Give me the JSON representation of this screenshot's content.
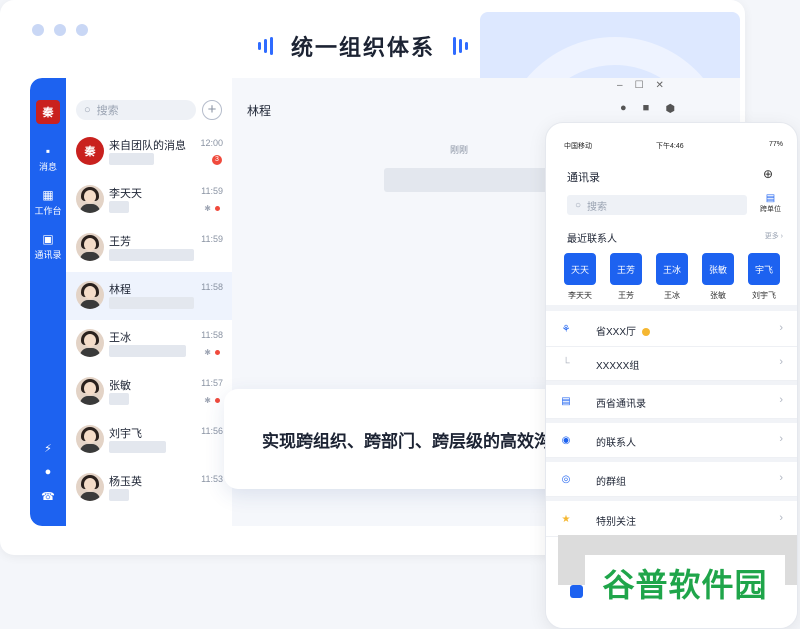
{
  "hero": {
    "title": "统一组织体系"
  },
  "desktop": {
    "search_placeholder": "搜索",
    "plus_icon": "+",
    "logo_text": "秦",
    "rail": [
      {
        "icon": "chat-icon",
        "label": "消息"
      },
      {
        "icon": "grid-icon",
        "label": "工作台"
      },
      {
        "icon": "contacts-icon",
        "label": "通讯录"
      }
    ],
    "chats": [
      {
        "name": "来自团队的消息",
        "time": "12:00",
        "badge": "3",
        "type": "team",
        "preview_w": 45
      },
      {
        "name": "李天天",
        "time": "11:59",
        "muted": true,
        "preview_w": 20
      },
      {
        "name": "王芳",
        "time": "11:59",
        "preview_w": 85
      },
      {
        "name": "林程",
        "time": "11:58",
        "active": true,
        "preview_w": 85
      },
      {
        "name": "王冰",
        "time": "11:58",
        "muted": true,
        "preview_w": 77
      },
      {
        "name": "张敏",
        "time": "11:57",
        "muted": true,
        "preview_w": 20
      },
      {
        "name": "刘宇飞",
        "time": "11:56",
        "preview_w": 57
      },
      {
        "name": "杨玉英",
        "time": "11:53",
        "preview_w": 20
      }
    ],
    "chat_title": "林程",
    "just_now": "刚刚",
    "window_controls": [
      "–",
      "☐",
      "✕"
    ]
  },
  "toast": {
    "text": "实现跨组织、跨部门、跨层级的高效沟通"
  },
  "phone": {
    "carrier": "中国移动",
    "time": "下午4:46",
    "battery": "77%",
    "title": "通讯录",
    "search_placeholder": "搜索",
    "unit_label": "跨单位",
    "recent_label": "最近联系人",
    "more_label": "更多",
    "recent": [
      {
        "short": "天天",
        "name": "李天天"
      },
      {
        "short": "王芳",
        "name": "王芳"
      },
      {
        "short": "王冰",
        "name": "王冰"
      },
      {
        "short": "张敏",
        "name": "张敏"
      },
      {
        "short": "宇飞",
        "name": "刘宇飞"
      }
    ],
    "rows": [
      {
        "icon": "org-icon",
        "label": "省XXX厅",
        "dot": true
      },
      {
        "icon": "branch-icon",
        "label": "XXXXX组"
      },
      {
        "icon": "book-icon",
        "label": "西省通讯录"
      },
      {
        "icon": "person-icon",
        "label": "的联系人"
      },
      {
        "icon": "group-icon",
        "label": "的群组"
      },
      {
        "icon": "star-icon",
        "label": "特别关注"
      }
    ]
  },
  "watermark": "谷普软件园"
}
